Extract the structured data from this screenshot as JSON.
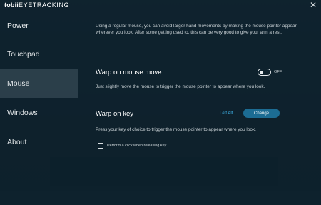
{
  "app": {
    "brand": "tobii",
    "brand_suffix": "EYETRACKING",
    "close_glyph": "✕"
  },
  "sidebar": {
    "items": [
      {
        "label": "Power",
        "active": false
      },
      {
        "label": "Touchpad",
        "active": false
      },
      {
        "label": "Mouse",
        "active": true
      },
      {
        "label": "Windows",
        "active": false
      },
      {
        "label": "About",
        "active": false
      }
    ]
  },
  "mouse": {
    "intro": "Using a regular mouse, you can avoid larger hand movements by making the mouse pointer appear wherever you look. After some getting used to, this can be very good to give your arm a rest.",
    "warp_move": {
      "title": "Warp on mouse move",
      "description": "Just slightly move the mouse to trigger the mouse pointer to appear where you look.",
      "toggle_state": "OFF"
    },
    "warp_key": {
      "title": "Warp on key",
      "current_key": "Left Alt",
      "change_label": "Change",
      "description": "Press your key of choice to trigger the mouse pointer to appear where you look.",
      "checkbox_label": "Perform a click when releasing key.",
      "checkbox_checked": false
    }
  },
  "colors": {
    "accent": "#3fb6ec",
    "button": "#1c6c93",
    "overlay": "#0c1e29"
  }
}
